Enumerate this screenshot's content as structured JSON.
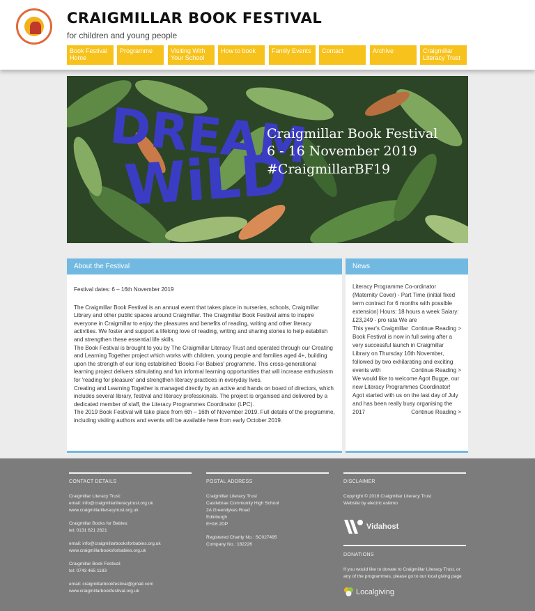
{
  "site": {
    "title": "CRAIGMILLAR BOOK FESTIVAL",
    "tagline": "for children and young people"
  },
  "nav": [
    {
      "label": "Book Festival Home"
    },
    {
      "label": "Programme"
    },
    {
      "label": "Visiting With Your School"
    },
    {
      "label": "How to book"
    },
    {
      "label": "Family Events"
    },
    {
      "label": "Contact"
    },
    {
      "label": "Archive"
    },
    {
      "label": "Craigmillar Literacy Trust"
    }
  ],
  "banner": {
    "art_text_1": "DREAM",
    "art_text_2": "WiLD",
    "line1": "Craigmillar Book Festival",
    "line2": "6 - 16 November 2019",
    "line3": "#CraigmillarBF19"
  },
  "about": {
    "heading": "About the Festival",
    "dates": "Festival dates: 6 – 16th November 2019",
    "p1": "The Craigmillar Book Festival is an annual event that takes place in nurseries, schools, Craigmillar Library and other public spaces around Craigmillar. The Craigmillar Book Festival aims to inspire everyone in Craigmillar to enjoy the pleasures and benefits of reading, writing and other literacy activities. We foster and support a lifelong love of reading, writing and sharing stories to help establish and strengthen these essential life skills.",
    "p2": "The Book Festival is brought to you by The Craigmillar Literacy Trust and operated through our Creating and Learning Together project which works with children, young people and families aged 4+, building upon the strength of our long established 'Books For Babies' programme. This cross-generational learning project delivers stimulating and fun informal learning opportunities that will increase enthusiasm for 'reading for pleasure' and strengthen literacy practices in everyday lives.",
    "p3": "Creating and Learning Together is managed directly by an active and hands on board of directors, which includes several library, festival and literacy professionals. The project is organised and delivered by a dedicated member of staff, the Literacy Programmes Coordinator (LPC).",
    "p4": "The 2019 Book Festival will take place from 6th – 16th of November 2019. Full details of the programme, including visiting authors and events will be available here from early October 2019."
  },
  "news": {
    "heading": "News",
    "items": [
      {
        "text": "Literacy Programme Co-ordinator (Maternity Cover) - Part Time (initial fixed term contract for 6 months with possible extension) Hours: 18 hours a week Salary: £23,249 - pro rata   We are",
        "more": ""
      },
      {
        "text": "This year's Craigmillar",
        "more": "Continue Reading >"
      },
      {
        "text": "Book Festival is now in full swing after a very successful launch in Craigmillar Library on Thursday 16th November, followed by two exhilarating and exciting events with",
        "more": "Continue Reading >"
      },
      {
        "text": "We would like to welcome Agot Bugge, our new Literacy Programmes Coordinator! Agot started with us on the last day of July and has been really busy organising the 2017",
        "more": "Continue Reading >"
      }
    ]
  },
  "footer": {
    "contact": {
      "heading": "CONTACT DETAILS",
      "trust_name": "Craigmillar Literacy Trust:",
      "trust_email": "email: info@craigmillarliteracytrust.org.uk",
      "trust_web": "www.craigmillarliteracytrust.org.uk",
      "babies_name": "Craigmillar Books for Babies:",
      "babies_tel": "tel: 0131 621 2621",
      "babies_email": "email: info@craigmillarbooksforbabies.org.uk",
      "babies_web": "www.craigmillarbooksforbabies.org.uk",
      "festival_name": "Craigmillar Book Festival:",
      "festival_tel": "tel: 0743 465 1183",
      "festival_email": "email: craigmillarbookfestival@gmail.com",
      "festival_web": "www.craigmillarbookfestival.org.uk"
    },
    "postal": {
      "heading": "POSTAL ADDRESS",
      "line1": "Craigmillar Literacy Trust",
      "line2": "Castlebrae Community High School",
      "line3": "2A Greendykes Road",
      "line4": "Edinburgh",
      "line5": "EH16 2DP",
      "charity": "Registered Charity No.: SC027495",
      "company": "Company No.: 182226"
    },
    "disclaimer": {
      "heading": "DISCLAIMER",
      "copyright": "Copyright © 2018 Craigmillar Literacy Trust",
      "credit": "Website by electric eskimo",
      "host_logo": "Vidahost"
    },
    "donations": {
      "heading": "DONATIONS",
      "text": "If you would like to donate to Craigmillar Literacy Trust, or any of the programmes, please go to our local giving page",
      "logo": "Localgiving"
    }
  },
  "colors": {
    "nav_bg": "#f7c21b",
    "panel_header": "#72b9e2",
    "footer_bg": "#7c7c7c",
    "banner_lettering": "#3b3cc4"
  }
}
